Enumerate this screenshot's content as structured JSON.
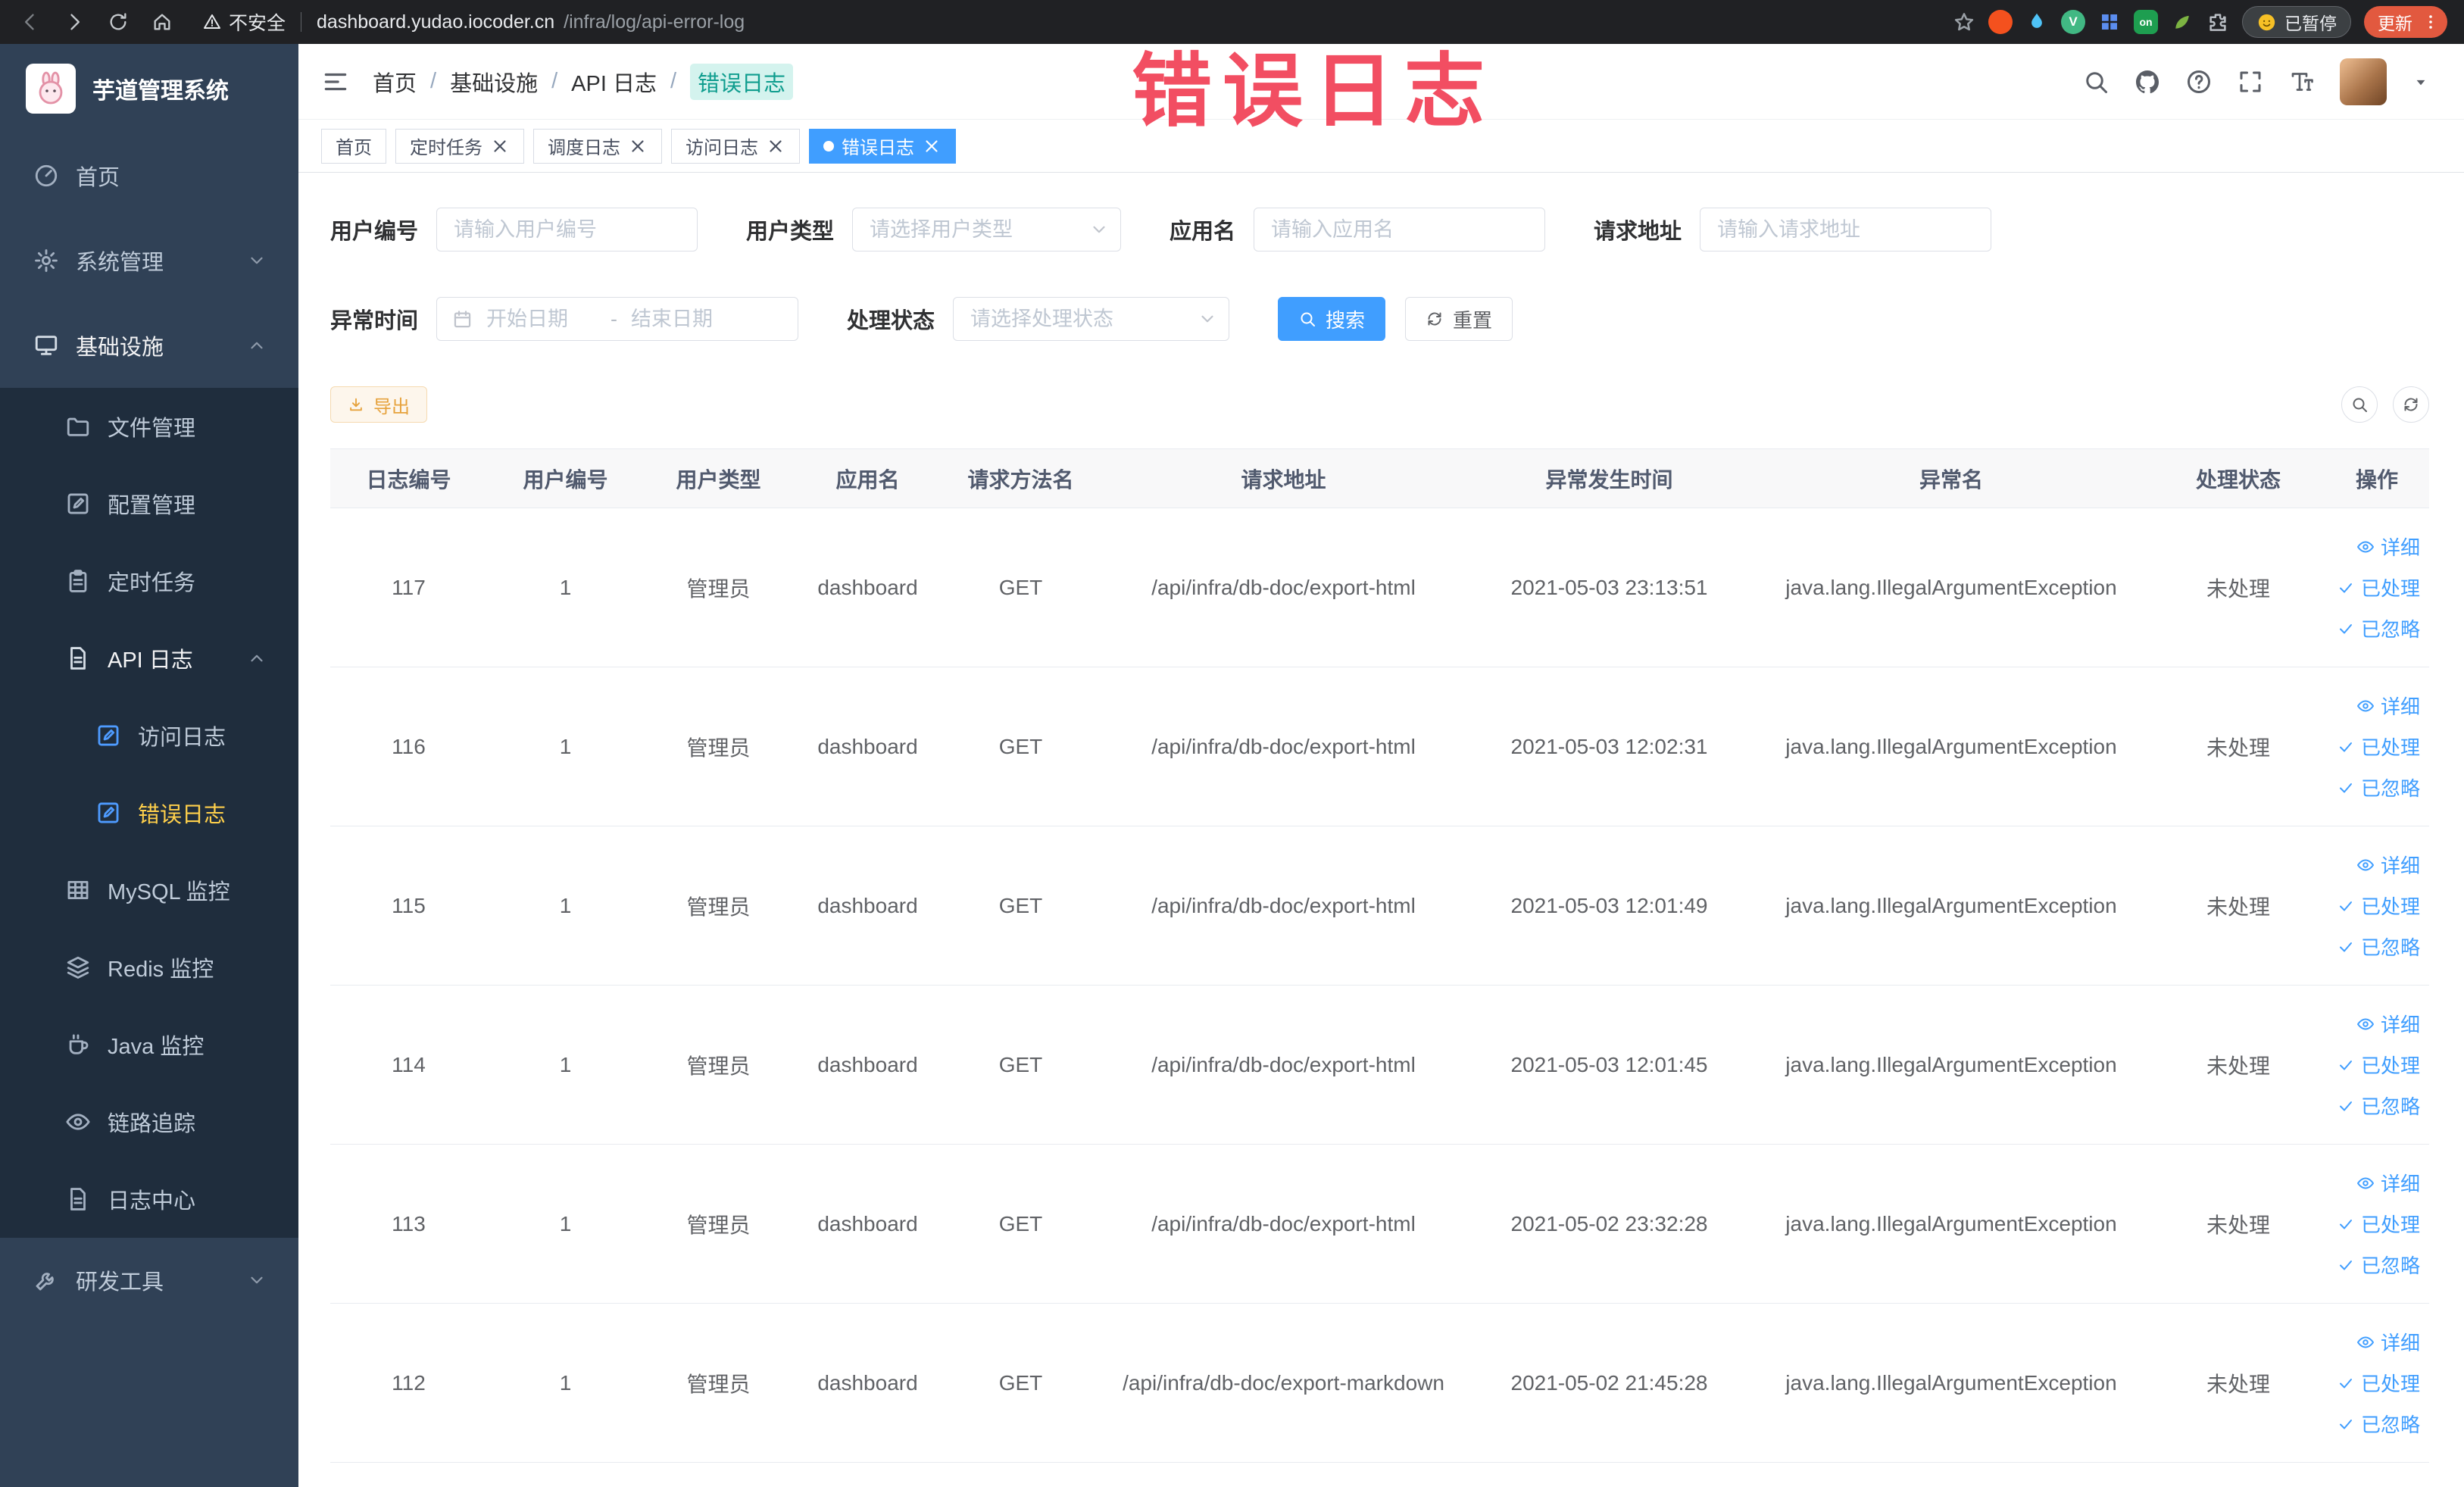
{
  "browser": {
    "security_label": "不安全",
    "url_host": "dashboard.yudao.iocoder.cn",
    "url_path": "/infra/log/api-error-log",
    "extensions": [
      {
        "name": "extension-icon-orange",
        "bg": "#f4511e"
      },
      {
        "name": "extension-icon-drop",
        "icon": "drop-icon",
        "color": "#4fc3f7"
      },
      {
        "name": "extension-icon-vue",
        "bg": "#41b883",
        "label": "V"
      },
      {
        "name": "extension-icon-grid",
        "icon": "grid4-icon",
        "color": "#5b8def"
      },
      {
        "name": "extension-icon-on",
        "bg": "#1e9e50",
        "label": "on",
        "square": true
      },
      {
        "name": "extension-icon-leaf",
        "icon": "leaf-icon",
        "color": "#7cb342"
      },
      {
        "name": "extension-icon-pin",
        "icon": "puzzle-icon",
        "color": "#b9bec4"
      }
    ],
    "profile_badge": "已暂停",
    "update_label": "更新"
  },
  "annotation": {
    "text": "错误日志",
    "color": "#f2455a"
  },
  "theme": {
    "primary": "#409eff",
    "sidebar_bg": "#304156",
    "submenu_bg": "#1f2d3d",
    "active_menu_text": "#ffd04b",
    "warning": "#e6a23c"
  },
  "sidebar": {
    "logo_title": "芋道管理系统",
    "items": [
      {
        "label": "首页",
        "icon": "gauge-icon",
        "level": 1
      },
      {
        "label": "系统管理",
        "icon": "gear-icon",
        "level": 1,
        "chevron": "down"
      },
      {
        "label": "基础设施",
        "icon": "monitor-icon",
        "level": 1,
        "chevron": "up",
        "open": true
      },
      {
        "label": "文件管理",
        "icon": "folder-icon",
        "level": 2
      },
      {
        "label": "配置管理",
        "icon": "edit-square-icon",
        "level": 2
      },
      {
        "label": "定时任务",
        "icon": "clipboard-icon",
        "level": 2
      },
      {
        "label": "API 日志",
        "icon": "doc-icon",
        "level": 2,
        "chevron": "up",
        "open": true
      },
      {
        "label": "访问日志",
        "icon": "edit-square-icon",
        "level": 3,
        "icon_color": "#4e9bff"
      },
      {
        "label": "错误日志",
        "icon": "edit-square-icon",
        "level": 3,
        "active": true,
        "icon_color": "#4e9bff"
      },
      {
        "label": "MySQL 监控",
        "icon": "table-grid-icon",
        "level": 2
      },
      {
        "label": "Redis 监控",
        "icon": "layers-icon",
        "level": 2
      },
      {
        "label": "Java 监控",
        "icon": "coffee-icon",
        "level": 2
      },
      {
        "label": "链路追踪",
        "icon": "eye-icon",
        "level": 2
      },
      {
        "label": "日志中心",
        "icon": "doc-icon",
        "level": 2
      },
      {
        "label": "研发工具",
        "icon": "wrench-icon",
        "level": 1,
        "chevron": "down"
      }
    ]
  },
  "breadcrumb": {
    "items": [
      "首页",
      "基础设施",
      "API 日志",
      "错误日志"
    ],
    "separator": "/"
  },
  "tabs": [
    {
      "label": "首页",
      "closable": false,
      "active": false
    },
    {
      "label": "定时任务",
      "closable": true,
      "active": false
    },
    {
      "label": "调度日志",
      "closable": true,
      "active": false
    },
    {
      "label": "访问日志",
      "closable": true,
      "active": false
    },
    {
      "label": "错误日志",
      "closable": true,
      "active": true
    }
  ],
  "filters": {
    "user_id": {
      "label": "用户编号",
      "placeholder": "请输入用户编号"
    },
    "user_type": {
      "label": "用户类型",
      "placeholder": "请选择用户类型"
    },
    "app_name": {
      "label": "应用名",
      "placeholder": "请输入应用名"
    },
    "request_url": {
      "label": "请求地址",
      "placeholder": "请输入请求地址"
    },
    "exception_time": {
      "label": "异常时间",
      "start_placeholder": "开始日期",
      "separator": "-",
      "end_placeholder": "结束日期"
    },
    "process_status": {
      "label": "处理状态",
      "placeholder": "请选择处理状态"
    },
    "search_button": "搜索",
    "reset_button": "重置"
  },
  "toolbar": {
    "export_button": "导出"
  },
  "table": {
    "columns": [
      "日志编号",
      "用户编号",
      "用户类型",
      "应用名",
      "请求方法名",
      "请求地址",
      "异常发生时间",
      "异常名",
      "处理状态",
      "操作"
    ],
    "action_labels": {
      "detail": "详细",
      "processed": "已处理",
      "ignored": "已忽略"
    },
    "rows": [
      {
        "log_id": "117",
        "user_id": "1",
        "user_type": "管理员",
        "app_name": "dashboard",
        "method": "GET",
        "url": "/api/infra/db-doc/export-html",
        "time": "2021-05-03 23:13:51",
        "exception": "java.lang.IllegalArgumentException",
        "status": "未处理"
      },
      {
        "log_id": "116",
        "user_id": "1",
        "user_type": "管理员",
        "app_name": "dashboard",
        "method": "GET",
        "url": "/api/infra/db-doc/export-html",
        "time": "2021-05-03 12:02:31",
        "exception": "java.lang.IllegalArgumentException",
        "status": "未处理"
      },
      {
        "log_id": "115",
        "user_id": "1",
        "user_type": "管理员",
        "app_name": "dashboard",
        "method": "GET",
        "url": "/api/infra/db-doc/export-html",
        "time": "2021-05-03 12:01:49",
        "exception": "java.lang.IllegalArgumentException",
        "status": "未处理"
      },
      {
        "log_id": "114",
        "user_id": "1",
        "user_type": "管理员",
        "app_name": "dashboard",
        "method": "GET",
        "url": "/api/infra/db-doc/export-html",
        "time": "2021-05-03 12:01:45",
        "exception": "java.lang.IllegalArgumentException",
        "status": "未处理"
      },
      {
        "log_id": "113",
        "user_id": "1",
        "user_type": "管理员",
        "app_name": "dashboard",
        "method": "GET",
        "url": "/api/infra/db-doc/export-html",
        "time": "2021-05-02 23:32:28",
        "exception": "java.lang.IllegalArgumentException",
        "status": "未处理"
      },
      {
        "log_id": "112",
        "user_id": "1",
        "user_type": "管理员",
        "app_name": "dashboard",
        "method": "GET",
        "url": "/api/infra/db-doc/export-markdown",
        "time": "2021-05-02 21:45:28",
        "exception": "java.lang.IllegalArgumentException",
        "status": "未处理"
      }
    ]
  }
}
